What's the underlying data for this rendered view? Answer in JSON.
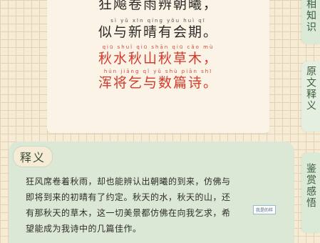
{
  "poem": {
    "lines": [
      {
        "pinyin": "",
        "text": "狂飚卷雨辨朝曦，",
        "highlight": false
      },
      {
        "pinyin": "sì  yǔ  xīn qíng yǒu huì  qī",
        "text": "似与新晴有会期。",
        "highlight": false
      },
      {
        "pinyin": "qiū shuǐ qiū shān qiū cǎo mù",
        "text": "秋水秋山秋草木，",
        "highlight": true
      },
      {
        "pinyin": "hún jiāng qǐ  yǔ  shù piān shī",
        "text": "浑将乞与数篇诗。",
        "highlight": true
      }
    ]
  },
  "tabs": [
    {
      "label": "相知识",
      "active": false
    },
    {
      "label": "原文释义",
      "active": true
    },
    {
      "label": "鉴赏感悟",
      "active": false
    }
  ],
  "explanation": {
    "title": "释义",
    "lines": [
      "狂风席卷着秋雨，却也能辨认出朝曦的到来，仿佛与",
      "即将到来的初晴有了约定。秋天的水，秋天的山，还",
      "有那秋天的草木，这一切美景都仿佛在向我乞求，希",
      "望能成为我诗中的几篇佳作。"
    ],
    "watermark": "我是的样"
  },
  "colors": {
    "highlight": "#d23a2c",
    "tab_bg": "#dbe9d7",
    "panel_bg": "#dbe8d5"
  }
}
